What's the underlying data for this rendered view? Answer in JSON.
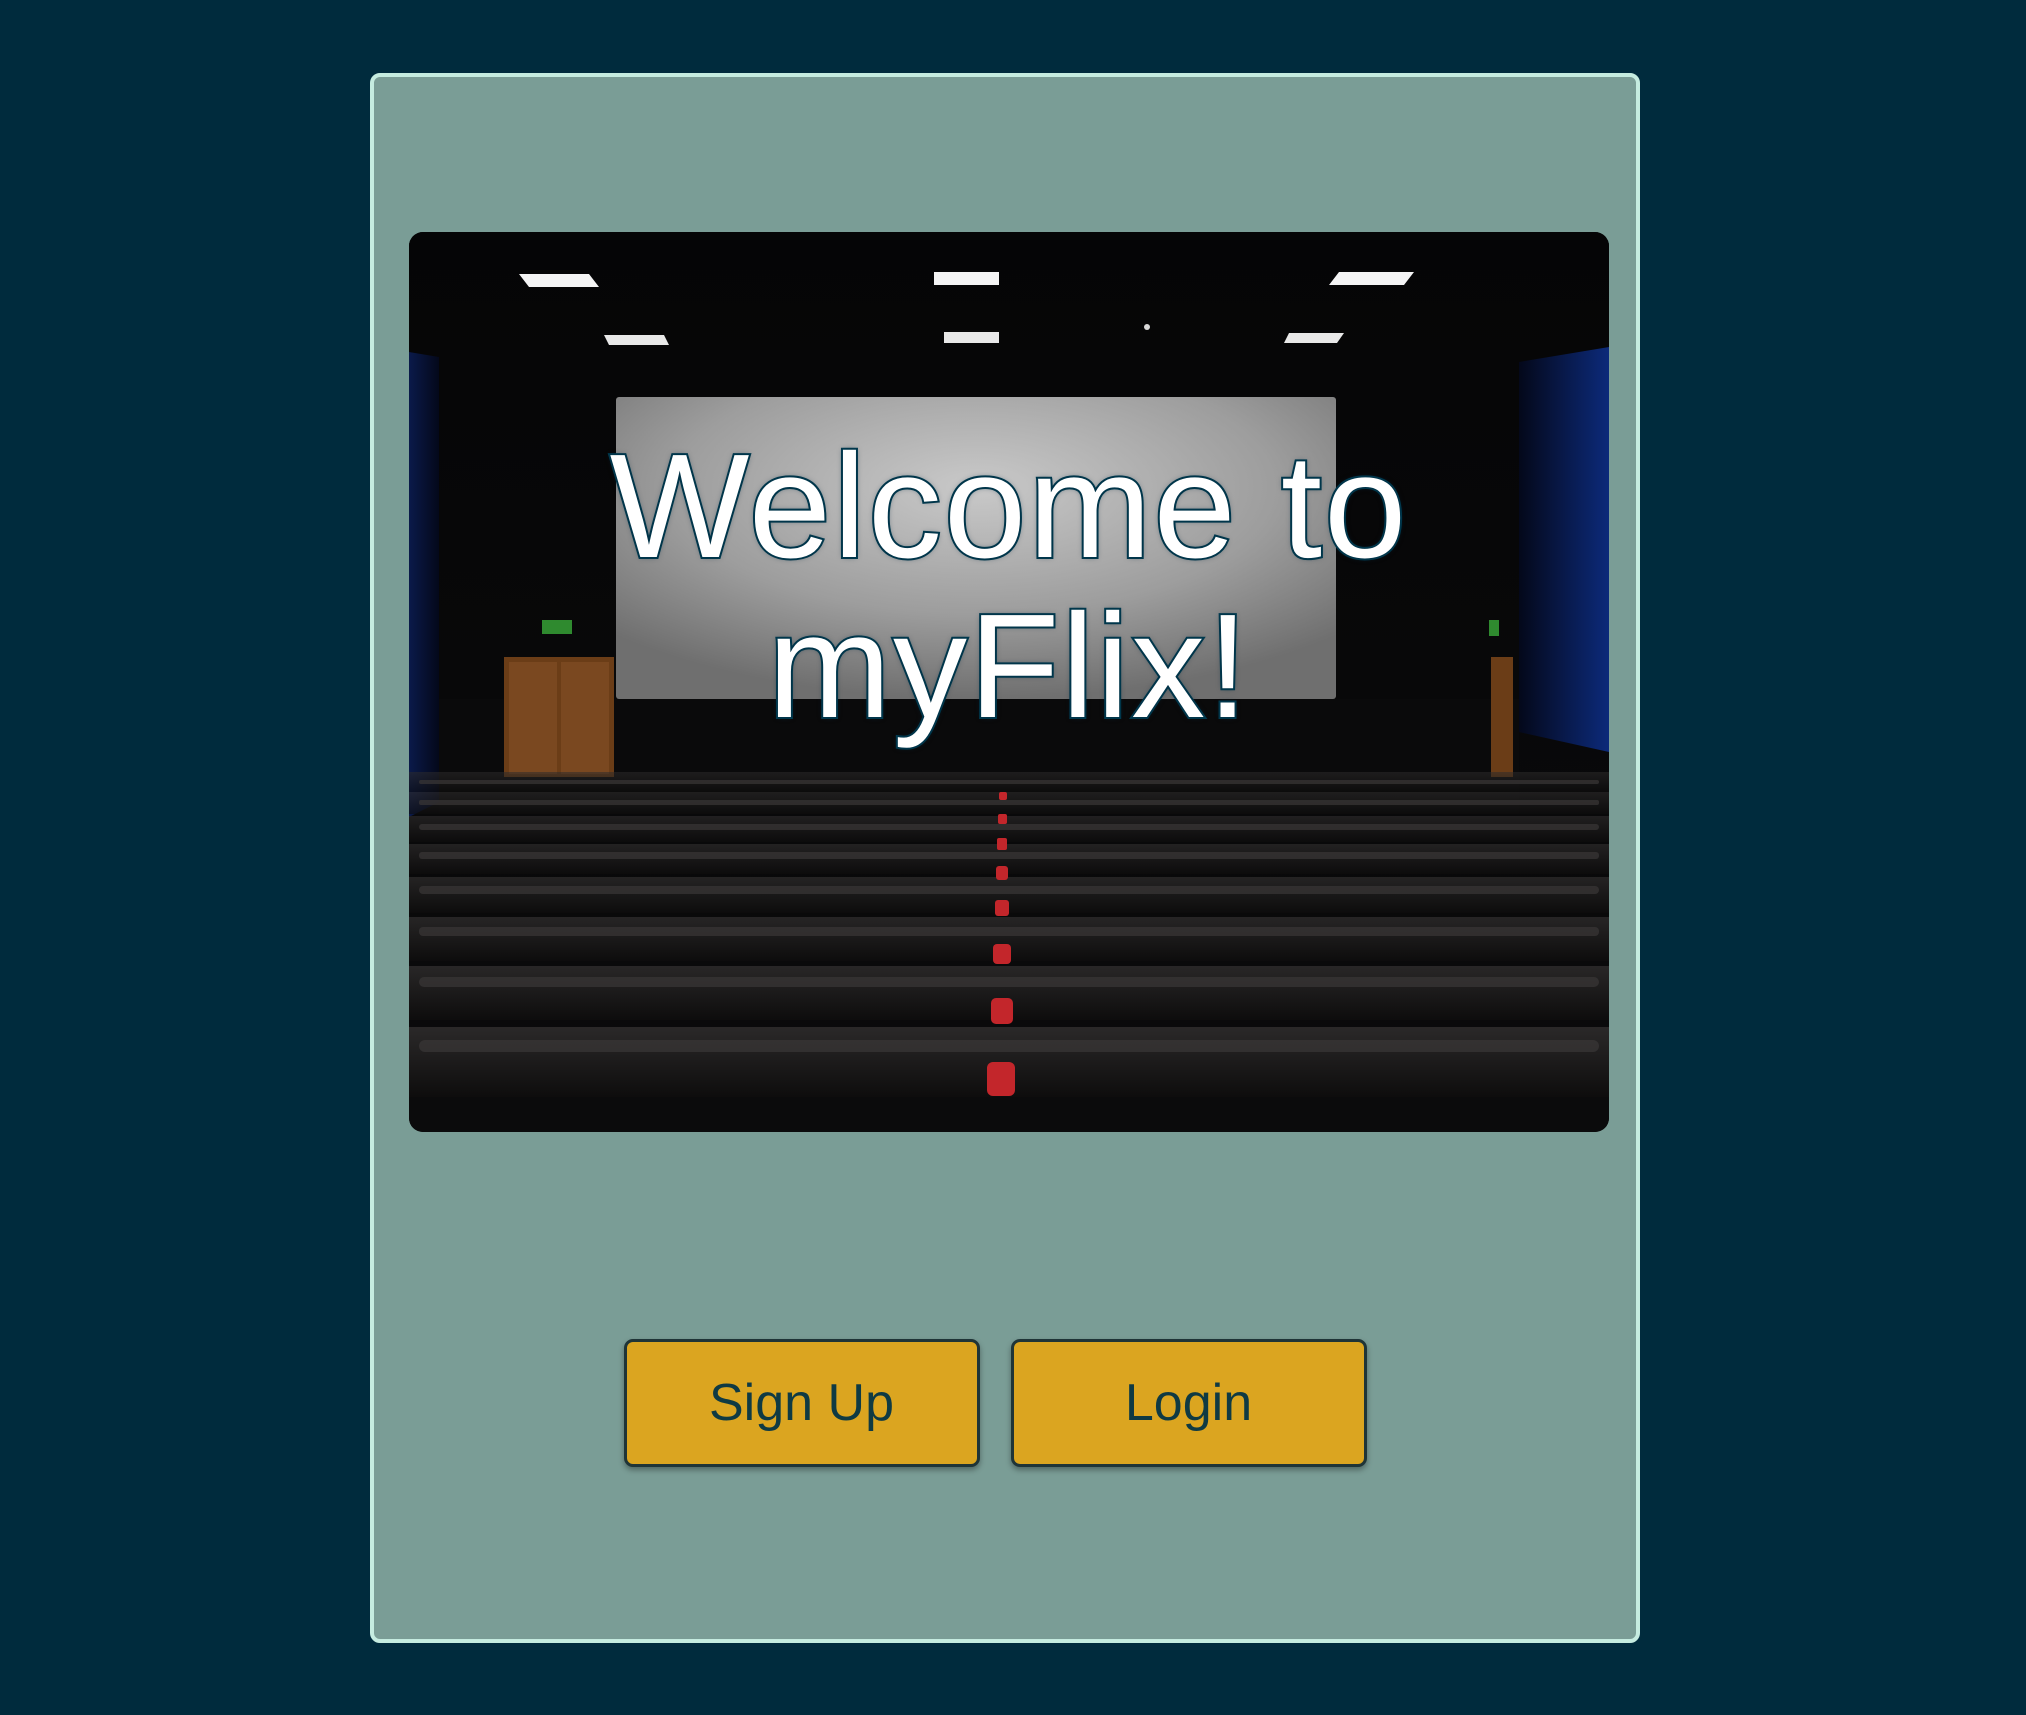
{
  "colors": {
    "page_background": "#002b3d",
    "card_background": "#7a9d96",
    "card_border": "#c5ece0",
    "button_background": "#dba520",
    "button_text": "#0f3a43",
    "title_fill": "#ffffff",
    "title_outline": "#003a4f"
  },
  "hero": {
    "title": "Welcome to myFlix!",
    "image_subject": "cinema-auditorium"
  },
  "actions": {
    "signup_label": "Sign Up",
    "login_label": "Login"
  }
}
